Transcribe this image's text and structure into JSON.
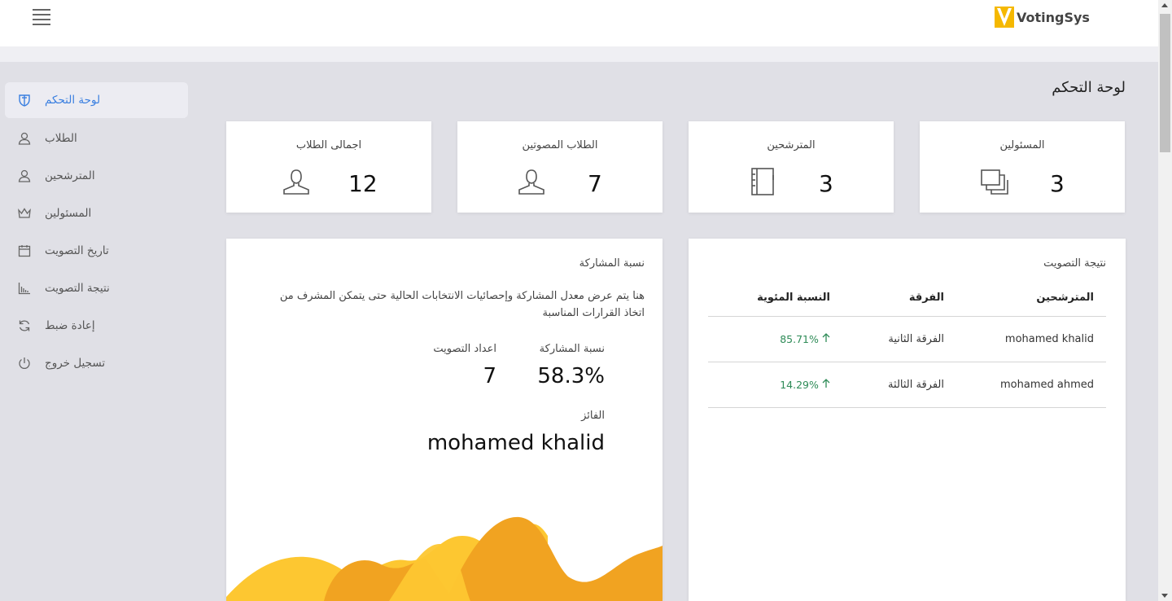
{
  "brand": {
    "name": "VotingSys"
  },
  "page_title": "لوحة التحكم",
  "sidebar": {
    "items": [
      {
        "label": "لوحة التحكم",
        "icon": "shield-icon",
        "active": true
      },
      {
        "label": "الطلاب",
        "icon": "user-icon"
      },
      {
        "label": "المترشحين",
        "icon": "user-icon"
      },
      {
        "label": "المسئولين",
        "icon": "crown-icon"
      },
      {
        "label": "تاريخ التصويت",
        "icon": "calendar-icon"
      },
      {
        "label": "نتيجة التصويت",
        "icon": "bar-chart-icon"
      },
      {
        "label": "إعادة ضبط",
        "icon": "refresh-icon"
      },
      {
        "label": "تسجيل خروج",
        "icon": "power-icon"
      }
    ]
  },
  "stats": {
    "total_students": {
      "title": "اجمالى الطلاب",
      "value": "12"
    },
    "voted_students": {
      "title": "الطلاب المصوتين",
      "value": "7"
    },
    "candidates": {
      "title": "المترشحين",
      "value": "3"
    },
    "admins": {
      "title": "المسئولين",
      "value": "3"
    }
  },
  "results": {
    "title": "نتيجة التصويت",
    "headers": {
      "candidate": "المترشحين",
      "team": "الفرقة",
      "percentage": "النسبة المئوية"
    },
    "rows": [
      {
        "candidate": "mohamed khalid",
        "team": "الفرقة الثانية",
        "percentage": "85.71%"
      },
      {
        "candidate": "mohamed ahmed",
        "team": "الفرقة الثالثة",
        "percentage": "14.29%"
      }
    ]
  },
  "participation": {
    "title": "نسبة المشاركة",
    "description": "هنا يتم عرض معدل المشاركة وإحصائيات الانتخابات الحالية حتى يتمكن المشرف من اتخاذ القرارات المناسبة",
    "rate_label": "نسبة المشاركة",
    "rate_value": "58.3%",
    "votes_label": "اعداد التصويت",
    "votes_value": "7",
    "winner_label": "الفائز",
    "winner_value": "mohamed khalid"
  },
  "colors": {
    "accent": "#3a7fe0",
    "brand_yellow": "#f5b800",
    "wave_light": "#fdc731",
    "wave_dark": "#f1a321",
    "positive": "#2e8b57"
  }
}
